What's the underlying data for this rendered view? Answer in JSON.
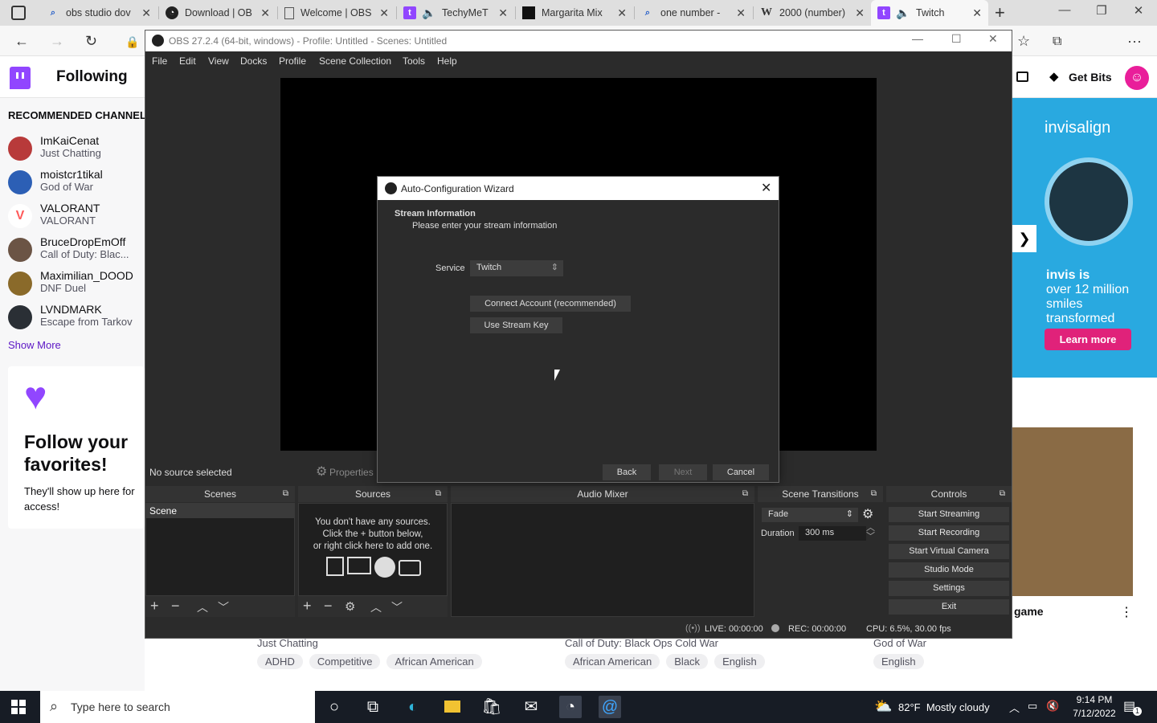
{
  "browser": {
    "tabs": [
      {
        "title": "obs studio dov",
        "icon": "search"
      },
      {
        "title": "Download | OB",
        "icon": "obs"
      },
      {
        "title": "Welcome | OBS",
        "icon": "page"
      },
      {
        "title": "TechyMeT",
        "icon": "twitch-audio"
      },
      {
        "title": "Margarita Mix",
        "icon": "thumbnail"
      },
      {
        "title": "one number -",
        "icon": "search"
      },
      {
        "title": "2000 (number)",
        "icon": "wikipedia"
      },
      {
        "title": "Twitch",
        "icon": "twitch-audio"
      }
    ],
    "new_tab_glyph": "+",
    "window_controls": [
      "—",
      "❐",
      "✕"
    ]
  },
  "twitch": {
    "following": "Following",
    "recommended": "RECOMMENDED CHANNELS",
    "channels": [
      {
        "name": "ImKaiCenat",
        "game": "Just Chatting",
        "color": "#b83a3a"
      },
      {
        "name": "moistcr1tikal",
        "game": "God of War",
        "color": "#2c5fb5"
      },
      {
        "name": "VALORANT",
        "game": "VALORANT",
        "color": "#ff5a5a"
      },
      {
        "name": "BruceDropEmOff",
        "game": "Call of Duty: Blac...",
        "color": "#6b5445"
      },
      {
        "name": "Maximilian_DOOD",
        "game": "DNF Duel",
        "color": "#8a6a2a"
      },
      {
        "name": "LVNDMARK",
        "game": "Escape from Tarkov",
        "color": "#2a2f35"
      }
    ],
    "show_more": "Show More",
    "follow_title": "Follow your favorites!",
    "follow_sub": "They'll show up here for access!",
    "get_bits": "Get Bits",
    "ad": {
      "brand": "invisalign",
      "headline_bold": "invis is",
      "headline": "over 12 million smiles transformed",
      "cta": "Learn more"
    },
    "game_label": "game",
    "bottom_games": [
      "Just Chatting",
      "Call of Duty: Black Ops Cold War",
      "God of War"
    ],
    "tags": [
      [
        "ADHD",
        "Competitive",
        "African American"
      ],
      [
        "African American",
        "Black",
        "English"
      ],
      [
        "English"
      ]
    ]
  },
  "obs": {
    "title": "OBS 27.2.4 (64-bit, windows) - Profile: Untitled - Scenes: Untitled",
    "menu": [
      "File",
      "Edit",
      "View",
      "Docks",
      "Profile",
      "Scene Collection",
      "Tools",
      "Help"
    ],
    "no_source": "No source selected",
    "properties": "Properties",
    "docks": {
      "scenes": "Scenes",
      "sources": "Sources",
      "audio": "Audio Mixer",
      "transitions": "Scene Transitions",
      "controls": "Controls"
    },
    "scene_item": "Scene",
    "sources_empty": [
      "You don't have any sources.",
      "Click the + button below,",
      "or right click here to add one."
    ],
    "transition": "Fade",
    "duration_label": "Duration",
    "duration_value": "300 ms",
    "controls": [
      "Start Streaming",
      "Start Recording",
      "Start Virtual Camera",
      "Studio Mode",
      "Settings",
      "Exit"
    ],
    "status": {
      "live": "LIVE: 00:00:00",
      "rec": "REC: 00:00:00",
      "cpu": "CPU: 6.5%, 30.00 fps"
    }
  },
  "wizard": {
    "title": "Auto-Configuration Wizard",
    "heading": "Stream Information",
    "subheading": "Please enter your stream information",
    "service_label": "Service",
    "service_value": "Twitch",
    "connect": "Connect Account (recommended)",
    "stream_key": "Use Stream Key",
    "back": "Back",
    "next": "Next",
    "cancel": "Cancel"
  },
  "taskbar": {
    "search_placeholder": "Type here to search",
    "weather": "82°F  Mostly cloudy",
    "time": "9:14 PM",
    "date": "7/12/2022",
    "notif_count": "1"
  }
}
